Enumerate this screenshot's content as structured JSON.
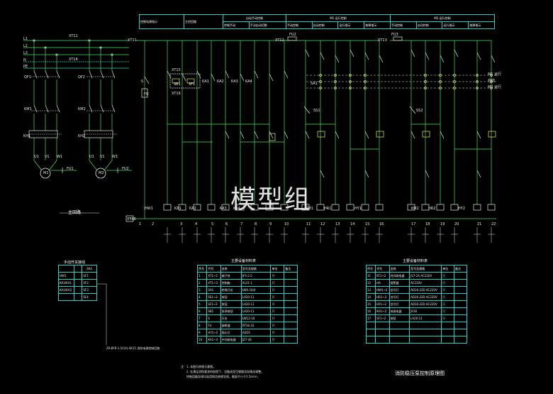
{
  "watermark": "模型组",
  "main_circuit": {
    "title": "主回路",
    "phases": [
      "L1",
      "L2",
      "L3",
      "N",
      "PE"
    ],
    "left": {
      "fuse": "QF1",
      "contactor": "KM1",
      "relay": "KH1",
      "motor": "M1",
      "fu": "FU1",
      "pe": "PE",
      "pins": [
        "1",
        "3",
        "5",
        "2",
        "4",
        "6"
      ],
      "out": [
        "U1",
        "V1",
        "W1"
      ]
    },
    "right": {
      "fuse": "QF2",
      "contactor": "KM2",
      "relay": "KH2",
      "motor": "M2",
      "fu": "FU2",
      "pe": "PE",
      "pins": [
        "1",
        "3",
        "5",
        "2",
        "4",
        "6"
      ],
      "out": [
        "U1",
        "V1",
        "W1"
      ]
    },
    "terminal_top": "XT11",
    "terminal_mid": "XT14"
  },
  "header_table": {
    "col1": "控制电源指示",
    "col2": "主控回路",
    "group1": "自动手动控制",
    "group2": "M1 运行控制",
    "group3": "M2 运行控制",
    "sub": [
      "控制手动",
      "手动自动切换",
      "手动控制",
      "自动控制",
      "运行指示",
      "故障指示",
      "手动控制",
      "自动控制",
      "运行指示",
      "故障指示"
    ]
  },
  "control_labels": {
    "left_xt": "XT11",
    "fu": "FU",
    "switch": "S",
    "xt15": "XT15",
    "sb1": "SB1",
    "sf1": "SF1",
    "xt16": "XT16",
    "ka_labels": [
      "KA1",
      "KA2",
      "KA3",
      "KA4"
    ],
    "sa1": "SA1",
    "fu2": "FU2",
    "fu3": "FU3",
    "xt12": "XT12",
    "xt13": "XT13",
    "ss1": "SS1",
    "ss2": "SS2",
    "km1": "KM1",
    "km2": "KM2",
    "coils": [
      "HW1",
      "KA1",
      "KA2",
      "KA3",
      "KA4",
      "KM1",
      "HR1",
      "HY1",
      "KM2",
      "HR2",
      "HY2"
    ],
    "selector": [
      "M1 运行",
      "自动",
      "M2 运行"
    ],
    "bottom_terminal": "XT16",
    "numbers": [
      "1",
      "2",
      "3",
      "4",
      "5",
      "6",
      "7",
      "8",
      "9",
      "10",
      "11",
      "12",
      "13",
      "14",
      "15",
      "16",
      "17",
      "18",
      "19",
      "20",
      "21",
      "22"
    ]
  },
  "selector_table": {
    "title": "手动开关接线",
    "head": "SA1",
    "rows": [
      {
        "a": "HW1",
        "b": "",
        "c": "SF1"
      },
      {
        "a": "KA3/KA1",
        "b": "",
        "c": "SF2"
      },
      {
        "a": "KA1/KA3",
        "b": "",
        "c": "SF3"
      },
      {
        "a": "",
        "b": "",
        "c": "SF4"
      }
    ],
    "note": "ZR-BYR-1.5(10)-SK15 消防电源控制回路"
  },
  "table1": {
    "title": "主要设备材料表",
    "header": [
      "序号",
      "代号",
      "名称",
      "型号及规格",
      "单位",
      "备注"
    ],
    "rows": [
      [
        "1",
        "XT1~2",
        "端子排",
        "JF5-2.5",
        "只",
        ""
      ],
      [
        "2",
        "XT1~3",
        "控制箱",
        "XL21-1",
        "只",
        ""
      ],
      [
        "3",
        "SA1",
        "转换开关",
        "LW5-16/4",
        "只",
        ""
      ],
      [
        "4",
        "SS1~2",
        "按钮",
        "LA20-11",
        "只",
        ""
      ],
      [
        "5",
        "SF1~2",
        "按钮",
        "LA20-11",
        "只",
        ""
      ],
      [
        "6",
        "SB1",
        "急停按钮",
        "LA20-11",
        "只",
        ""
      ],
      [
        "7",
        "S",
        "开关",
        "LW12-16",
        "只",
        ""
      ],
      [
        "8",
        "FU",
        "熔断器",
        "RT18-32",
        "只",
        ""
      ],
      [
        "9",
        "HY1~2",
        "指示灯",
        "AD16",
        "只",
        ""
      ],
      [
        "10",
        "KA1~4",
        "中间继电器",
        "JZ7-44",
        "只",
        ""
      ]
    ]
  },
  "table2": {
    "title": "主要设备材料表",
    "header": [
      "序号",
      "代号",
      "名称",
      "型号及规格",
      "单位",
      "备注"
    ],
    "rows": [
      [
        "11",
        "KT1~2",
        "时间继电器",
        "JS7-2A AC220V",
        "只",
        ""
      ],
      [
        "12",
        "HA",
        "报警器",
        "AC220V",
        "只",
        ""
      ],
      [
        "13",
        "HW1~2",
        "信号灯",
        "AD16-22D AC220V",
        "只",
        ""
      ],
      [
        "14",
        "HR1~2",
        "信号灯",
        "AD16-22D AC220V",
        "只",
        ""
      ],
      [
        "15",
        "HY1~2",
        "信号灯",
        "AD16-22D AC220V",
        "只",
        ""
      ],
      [
        "16",
        "KH1~2",
        "热继电器",
        "JR36",
        "只",
        ""
      ],
      [
        "17",
        "SF1~2",
        "按钮",
        "LA20-11",
        "只",
        ""
      ],
      [
        "",
        "",
        "",
        "",
        "",
        ""
      ],
      [
        "",
        "",
        "",
        "",
        "",
        ""
      ],
      [
        "",
        "",
        "",
        "",
        "",
        ""
      ]
    ]
  },
  "notes": {
    "label": "注：",
    "lines": [
      "1. 本图为原理示意图。",
      "2. 在满足消防要求的前提下，设备选型可根据实际情况调整。",
      "   控制回路导线均采用铜芯绝缘导线，截面不小于1.5mm²。"
    ]
  },
  "drawing_title": "消防稳压泵控制原理图"
}
